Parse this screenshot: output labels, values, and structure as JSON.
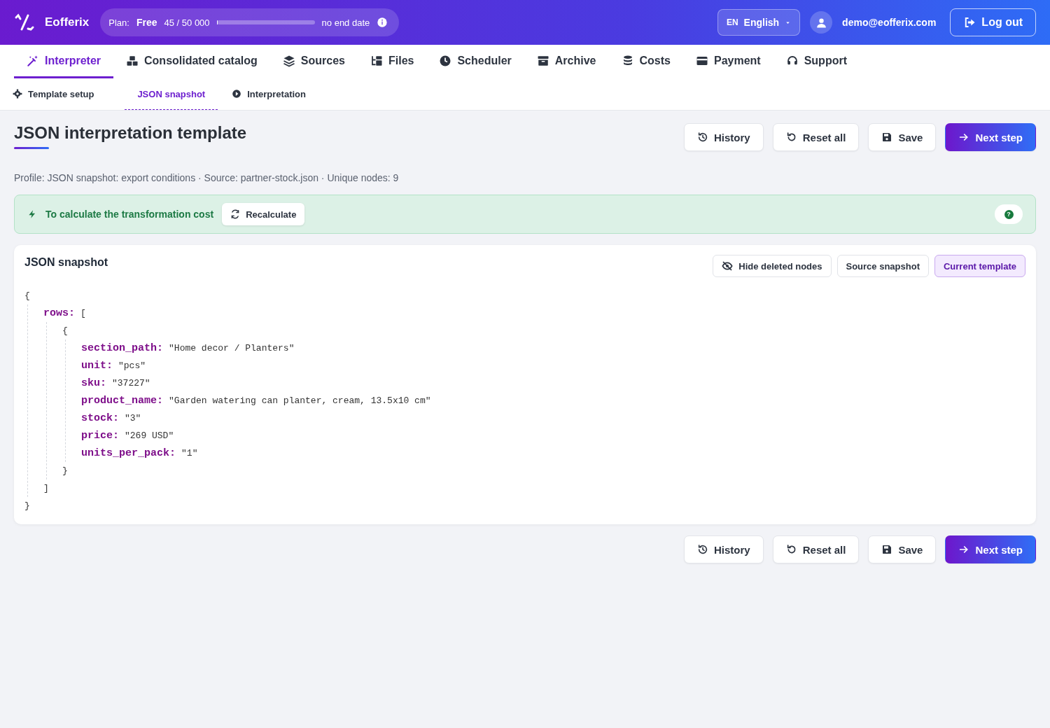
{
  "header": {
    "brand": "Eofferix",
    "plan": {
      "label": "Plan:",
      "name": "Free",
      "usage": "45 / 50 000",
      "level": 0.001,
      "end": "no end date"
    },
    "language": {
      "code": "EN",
      "name": "English"
    },
    "user": "demo@eofferix.com",
    "logout": "Log out"
  },
  "nav": [
    {
      "label": "Interpreter",
      "kind": "wand",
      "selected": true
    },
    {
      "label": "Consolidated catalog",
      "kind": "boxes",
      "selected": false
    },
    {
      "label": "Sources",
      "kind": "layers",
      "selected": false
    },
    {
      "label": "Files",
      "kind": "tree",
      "selected": false
    },
    {
      "label": "Scheduler",
      "kind": "clock",
      "selected": false
    },
    {
      "label": "Archive",
      "kind": "archive",
      "selected": false
    },
    {
      "label": "Costs",
      "kind": "coins",
      "selected": false
    },
    {
      "label": "Payment",
      "kind": "card",
      "selected": false
    },
    {
      "label": "Support",
      "kind": "headset",
      "selected": false
    }
  ],
  "subnav": [
    {
      "label": "Template setup",
      "kind": "gear",
      "selected": false
    },
    {
      "label": "JSON snapshot",
      "kind": "plain",
      "selected": true
    },
    {
      "label": "Interpretation",
      "kind": "play",
      "selected": false
    }
  ],
  "page": {
    "title": "JSON interpretation template",
    "meta": "Profile: JSON snapshot: export conditions · Source: partner-stock.json · Unique nodes: 9"
  },
  "toolbar_top": [
    {
      "label": "History",
      "kind": "history"
    },
    {
      "label": "Reset all",
      "kind": "reset"
    },
    {
      "label": "Save",
      "kind": "save"
    },
    {
      "label": "Next step",
      "kind": "next"
    }
  ],
  "notice": {
    "text": "To calculate the transformation cost",
    "button": "Recalculate",
    "help": "?"
  },
  "snapshot": {
    "title": "JSON snapshot",
    "toggles": [
      {
        "label": "Hide deleted nodes",
        "kind": "eye-off",
        "selected": false
      },
      {
        "label": "Source snapshot",
        "kind": "plain",
        "selected": false
      },
      {
        "label": "Current template",
        "kind": "plain",
        "selected": true
      }
    ],
    "json": {
      "open": "{",
      "close": "}",
      "children": [
        {
          "key": "rows:",
          "open": "[",
          "close": "]",
          "children": [
            {
              "open": "{",
              "close": "}",
              "children": [
                {
                  "key": "section_path:",
                  "value": "\"Home decor / Planters\""
                },
                {
                  "key": "unit:",
                  "value": "\"pcs\""
                },
                {
                  "key": "sku:",
                  "value": "\"37227\""
                },
                {
                  "key": "product_name:",
                  "value": "\"Garden watering can planter, cream, 13.5x10 cm\""
                },
                {
                  "key": "stock:",
                  "value": "\"3\""
                },
                {
                  "key": "price:",
                  "value": "\"269 USD\""
                },
                {
                  "key": "units_per_pack:",
                  "value": "\"1\""
                }
              ]
            }
          ]
        }
      ]
    }
  },
  "toolbar_bottom": [
    {
      "label": "History",
      "kind": "history"
    },
    {
      "label": "Reset all",
      "kind": "reset"
    },
    {
      "label": "Save",
      "kind": "save"
    },
    {
      "label": "Next step",
      "kind": "next"
    }
  ]
}
